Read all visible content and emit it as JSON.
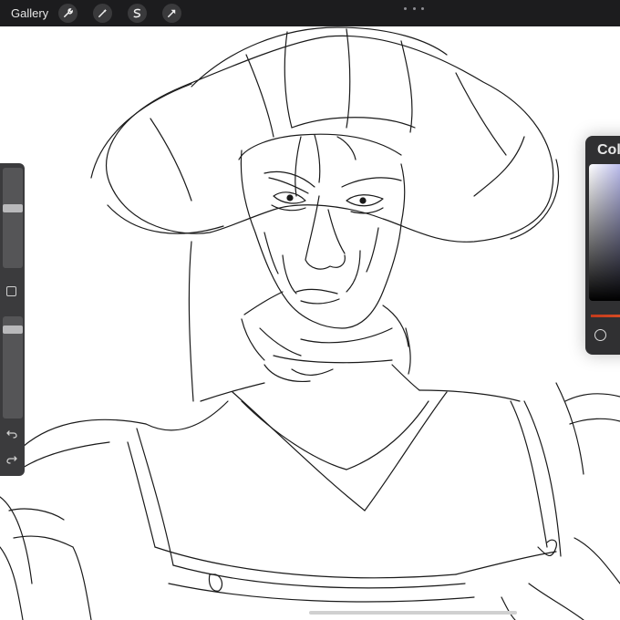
{
  "topbar": {
    "gallery_label": "Gallery",
    "tools": [
      "wrench-icon",
      "magic-wand-icon",
      "selection-icon",
      "transform-arrow-icon"
    ],
    "more_icon": "ellipsis-icon"
  },
  "sidebar": {
    "brush_size_level": 0.6,
    "opacity_level": 0.1,
    "modify_icon": "square-icon",
    "undo_icon": "undo-icon",
    "redo_icon": "redo-icon"
  },
  "color_panel": {
    "title": "Colors",
    "accent_color": "#e0552a",
    "hue_marker_icon": "circle-icon"
  },
  "canvas": {
    "background": "#ffffff",
    "stroke_color": "#1a1a1a"
  }
}
